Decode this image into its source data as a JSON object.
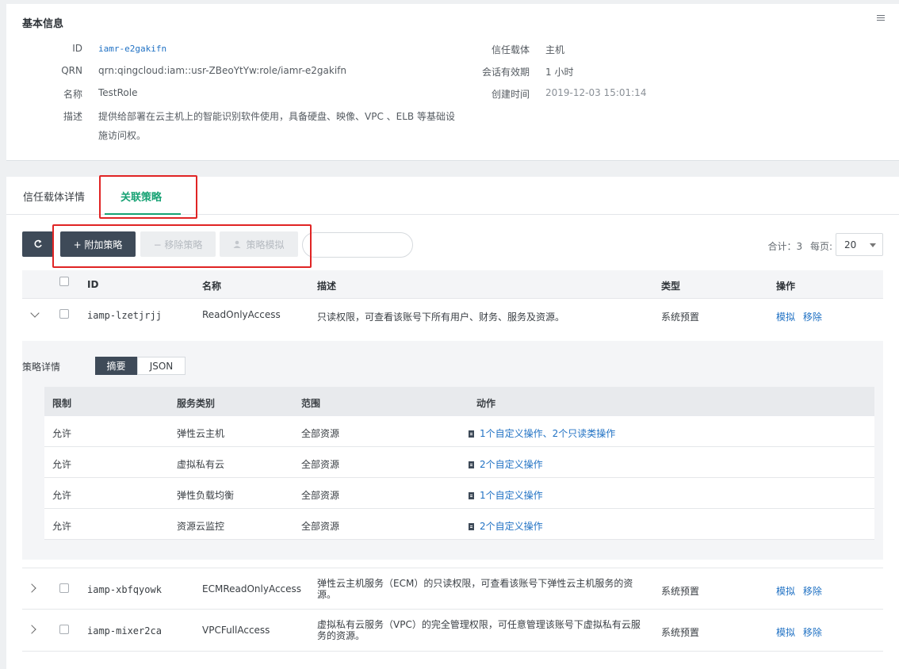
{
  "basic_info": {
    "title": "基本信息",
    "id_label": "ID",
    "id_value": "iamr-e2gakifn",
    "qrn_label": "QRN",
    "qrn_value": "qrn:qingcloud:iam::usr-ZBeoYtYw:role/iamr-e2gakifn",
    "name_label": "名称",
    "name_value": "TestRole",
    "desc_label": "描述",
    "desc_line1": "提供给部署在云主机上的智能识别软件使用，具备硬盘、映像、VPC 、ELB 等基础设",
    "desc_line2": "施访问权。",
    "trust_label": "信任载体",
    "trust_value": "主机",
    "session_label": "会话有效期",
    "session_value": "1 小时",
    "created_label": "创建时间",
    "created_value": "2019-12-03 15:01:14"
  },
  "tabs": [
    {
      "label": "信任载体详情"
    },
    {
      "label": "关联策略"
    }
  ],
  "toolbar": {
    "attach_label": "+ 附加策略",
    "remove_label": "− 移除策略",
    "simulate_label": "策略模拟",
    "total_text": "合计：3",
    "per_page_label": "每页:",
    "per_page_value": "20"
  },
  "table": {
    "headers": {
      "id": "ID",
      "name": "名称",
      "desc": "描述",
      "type": "类型",
      "ops": "操作"
    },
    "rows": [
      {
        "id": "iamp-lzetjrjj",
        "name": "ReadOnlyAccess",
        "desc1": "只读权限，可查看该账号下所有用户、财务、服务及资源。",
        "desc2": "",
        "type": "系统预置",
        "simulate": "模拟",
        "remove": "移除"
      },
      {
        "id": "iamp-xbfqyowk",
        "name": "ECMReadOnlyAccess",
        "desc1": "弹性云主机服务（ECM）的只读权限，可查看该账号下弹性云主机服务的资",
        "desc2": "源。",
        "type": "系统预置",
        "simulate": "模拟",
        "remove": "移除"
      },
      {
        "id": "iamp-mixer2ca",
        "name": "VPCFullAccess",
        "desc1": "虚拟私有云服务（VPC）的完全管理权限，可任意管理该账号下虚拟私有云服",
        "desc2": "务的资源。",
        "type": "系统预置",
        "simulate": "模拟",
        "remove": "移除"
      }
    ]
  },
  "detail": {
    "label": "策略详情",
    "seg_summary": "摘要",
    "seg_json": "JSON",
    "headers": {
      "effect": "限制",
      "service": "服务类别",
      "scope": "范围",
      "action": "动作"
    },
    "rows": [
      {
        "effect": "允许",
        "service": "弹性云主机",
        "scope": "全部资源",
        "action": "1个自定义操作、2个只读类操作"
      },
      {
        "effect": "允许",
        "service": "虚拟私有云",
        "scope": "全部资源",
        "action": "2个自定义操作"
      },
      {
        "effect": "允许",
        "service": "弹性负载均衡",
        "scope": "全部资源",
        "action": "1个自定义操作"
      },
      {
        "effect": "允许",
        "service": "资源云监控",
        "scope": "全部资源",
        "action": "2个自定义操作"
      }
    ]
  },
  "colors": {
    "accent_green": "#17a274",
    "link_blue": "#2172c4",
    "dark_button": "#3e4a58",
    "highlight_red": "#e02424"
  }
}
